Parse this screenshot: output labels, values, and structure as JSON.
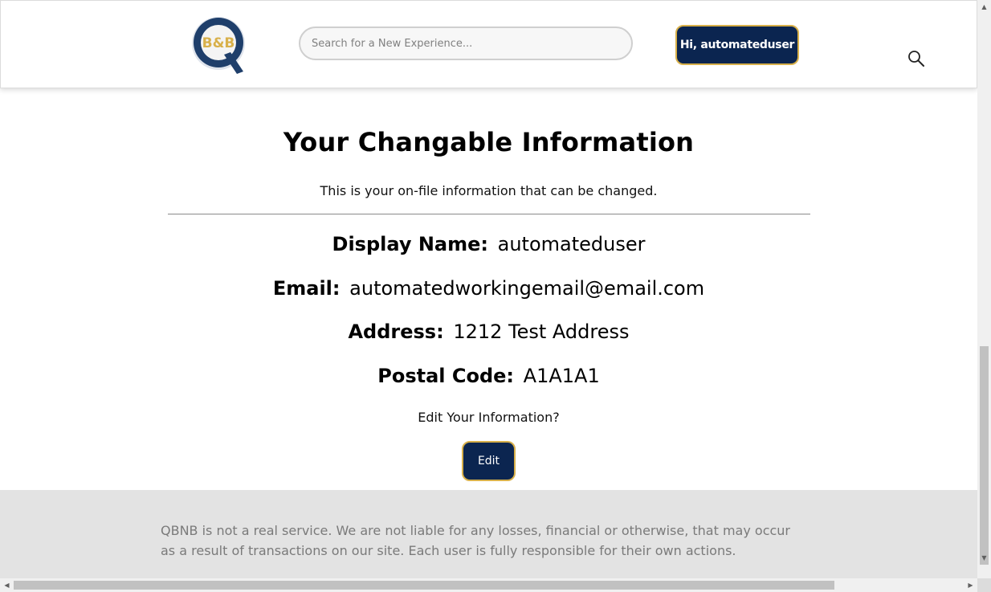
{
  "header": {
    "logo_text": "B&B",
    "search_placeholder": "Search for a New Experience...",
    "search_value": "",
    "user_button_label": "Hi, automateduser",
    "search_icon": "search-icon"
  },
  "main": {
    "title": "Your Changable Information",
    "subtitle": "This is your on-file information that can be changed.",
    "fields": {
      "display_name": {
        "label": "Display Name:",
        "value": "automateduser"
      },
      "email": {
        "label": "Email:",
        "value": "automatedworkingemail@email.com"
      },
      "address": {
        "label": "Address:",
        "value": "1212 Test Address"
      },
      "postal_code": {
        "label": "Postal Code:",
        "value": "A1A1A1"
      }
    },
    "edit_prompt": "Edit Your Information?",
    "edit_button_label": "Edit"
  },
  "footer": {
    "disclaimer_line1": "QBNB is not a real service. We are not liable for any losses, financial or otherwise, that may occur",
    "disclaimer_line2": "as a result of transactions on our site. Each user is fully responsible for their own actions."
  },
  "colors": {
    "brand_navy": "#0b2550",
    "brand_gold": "#d8b04a",
    "logo_red": "#a3222c",
    "footer_bg": "#e3e3e3",
    "footer_text": "#7a7a7a"
  }
}
